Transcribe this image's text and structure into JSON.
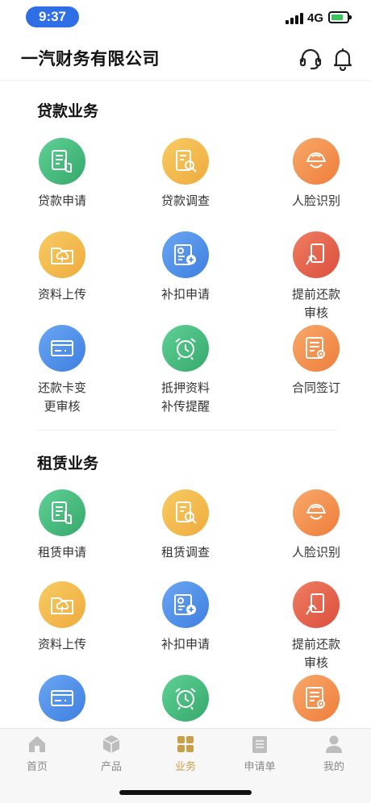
{
  "status": {
    "time": "9:37",
    "network": "4G"
  },
  "header": {
    "title": "一汽财务有限公司",
    "support_icon": "headset-icon",
    "bell_icon": "bell-icon"
  },
  "sections": [
    {
      "title": "贷款业务",
      "items": [
        {
          "label": "贷款申请",
          "icon": "hand-doc-icon",
          "color": "green"
        },
        {
          "label": "贷款调查",
          "icon": "doc-search-icon",
          "color": "yellow"
        },
        {
          "label": "人脸识别",
          "icon": "face-icon",
          "color": "orange"
        },
        {
          "label": "资料上传",
          "icon": "folder-upload-icon",
          "color": "yellow"
        },
        {
          "label": "补扣申请",
          "icon": "id-card-icon",
          "color": "blue"
        },
        {
          "label": "提前还款\n审核",
          "icon": "card-hand-icon",
          "color": "red"
        },
        {
          "label": "还款卡变\n更审核",
          "icon": "bank-card-icon",
          "color": "blue"
        },
        {
          "label": "抵押资料\n补传提醒",
          "icon": "alarm-clock-icon",
          "color": "green"
        },
        {
          "label": "合同签订",
          "icon": "contract-icon",
          "color": "orange"
        }
      ]
    },
    {
      "title": "租赁业务",
      "items": [
        {
          "label": "租赁申请",
          "icon": "hand-doc-icon",
          "color": "green"
        },
        {
          "label": "租赁调查",
          "icon": "doc-search-icon",
          "color": "yellow"
        },
        {
          "label": "人脸识别",
          "icon": "face-icon",
          "color": "orange"
        },
        {
          "label": "资料上传",
          "icon": "folder-upload-icon",
          "color": "yellow"
        },
        {
          "label": "补扣申请",
          "icon": "id-card-icon",
          "color": "blue"
        },
        {
          "label": "提前还款\n审核",
          "icon": "card-hand-icon",
          "color": "red"
        },
        {
          "label": "",
          "icon": "bank-card-icon",
          "color": "blue"
        },
        {
          "label": "",
          "icon": "alarm-clock-icon",
          "color": "green"
        },
        {
          "label": "",
          "icon": "contract-icon",
          "color": "orange"
        }
      ]
    }
  ],
  "tabs": [
    {
      "label": "首页",
      "icon": "home-icon",
      "active": false
    },
    {
      "label": "产品",
      "icon": "box-icon",
      "active": false
    },
    {
      "label": "业务",
      "icon": "grid-icon",
      "active": true
    },
    {
      "label": "申请单",
      "icon": "list-icon",
      "active": false
    },
    {
      "label": "我的",
      "icon": "user-icon",
      "active": false
    }
  ],
  "colors": {
    "accent": "#c9a04a",
    "time_pill": "#2f6fe6"
  }
}
